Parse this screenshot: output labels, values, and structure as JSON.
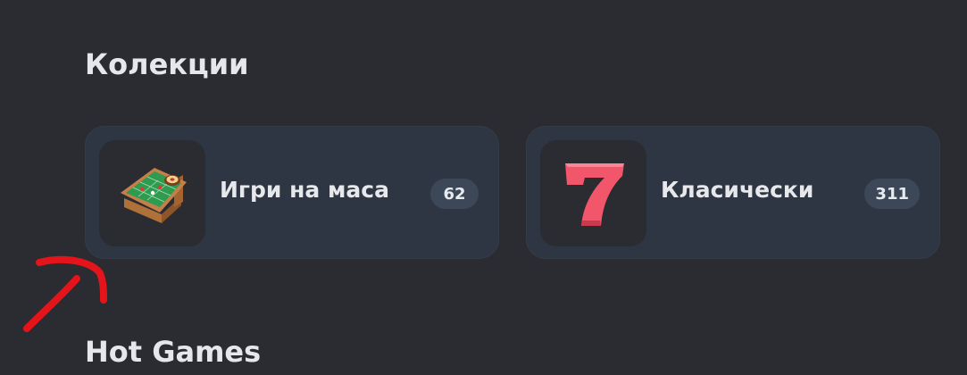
{
  "sections": {
    "collections_title": "Колекции",
    "hot_games_title": "Hot Games"
  },
  "collections": [
    {
      "label": "Игри на маса",
      "count": "62",
      "icon": "roulette-table-icon"
    },
    {
      "label": "Класически",
      "count": "311",
      "icon": "lucky-seven-icon"
    }
  ],
  "colors": {
    "background": "#2a2c31",
    "card": "#2f3643",
    "badge": "#3c4858",
    "seven": "#f2566a",
    "annotation": "#e5141b"
  }
}
